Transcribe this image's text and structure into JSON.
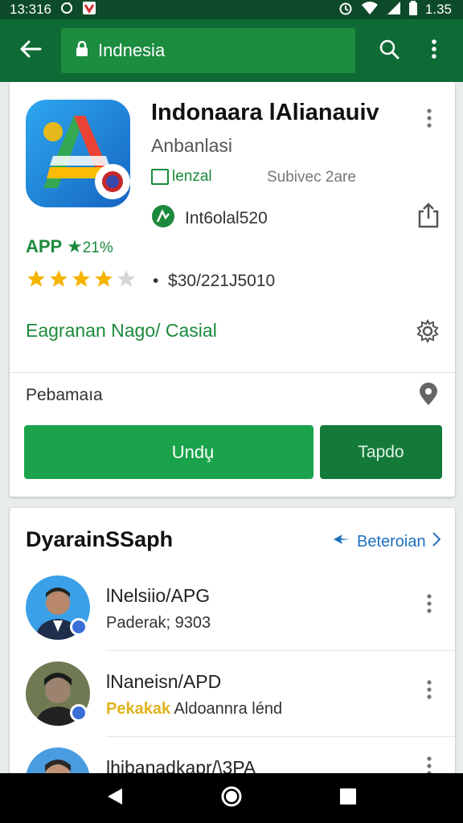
{
  "status_bar": {
    "time_left": "13:316",
    "time_right": "1.35",
    "icons": [
      "alarm-icon",
      "wifi-icon",
      "signal-icon",
      "battery-icon"
    ]
  },
  "app_bar": {
    "search_text": "Indnesia",
    "icons": [
      "back-arrow-icon",
      "lock-icon",
      "search-icon",
      "more-vert-icon"
    ]
  },
  "app": {
    "title": "Indonaara lAlianauiv",
    "subtitle": "Anbanlasi",
    "badge_label": "lenzal",
    "subtext": "Subivec 2are",
    "developer": "Int6olal520",
    "rank_prefix": "APP",
    "rank_value": "21%",
    "rating_stars": 4,
    "rating_max": 5,
    "price_bullet": "•",
    "price": "$30/221J5010",
    "category": "Eagranan Nago/ Casial",
    "section_label": "Pebamaıa",
    "install_label": "Undu̧",
    "secondary_label": "Tapdo"
  },
  "related": {
    "title": "DyarainSSaph",
    "more_label": "Beteroian",
    "items": [
      {
        "name": "lNelsiio/APG",
        "sub": "Paderak; 9303",
        "stars_text": ""
      },
      {
        "name": "lNaneisn/APD",
        "sub": "Aldoannra lénd",
        "stars_text": "Pekakak"
      },
      {
        "name": "lhibanadkapr/\\3PA",
        "sub": "",
        "stars_text": ""
      }
    ]
  },
  "colors": {
    "status_bar": "#0d4a2a",
    "app_bar": "#0e6b36",
    "accent_green": "#1aa34a",
    "link_blue": "#1f6fbf",
    "star": "#f4b400"
  }
}
